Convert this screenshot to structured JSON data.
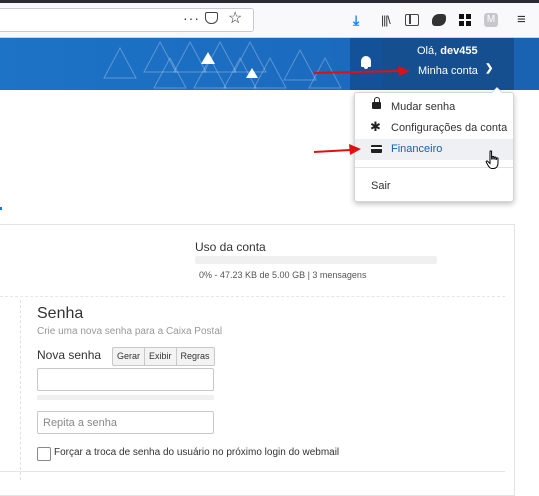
{
  "browser": {
    "url_actions_icon": "ellipsis-icon",
    "pocket_icon": "pocket-icon",
    "bookmark_icon": "star-icon",
    "toolbar_icons": [
      "download-icon",
      "library-icon",
      "sidebar-icon",
      "extension-icon",
      "grid-extension-icon",
      "profile-extension-icon",
      "hamburger-menu-icon"
    ],
    "profile_badge": "M"
  },
  "header": {
    "greeting_prefix": "Olá,",
    "username": "dev455",
    "account_menu_label": "Minha conta",
    "brand_color": "#1d73c6"
  },
  "account_menu": {
    "items": [
      {
        "label": "Mudar senha",
        "icon": "lock-icon"
      },
      {
        "label": "Configurações da conta",
        "icon": "gear-icon"
      },
      {
        "label": "Financeiro",
        "icon": "credit-card-icon",
        "highlighted": true
      },
      {
        "label": "Sair"
      }
    ]
  },
  "usage": {
    "title": "Uso da conta",
    "summary": "0% - 47.23 KB de 5.00 GB | 3 mensagens",
    "percent_used": 0
  },
  "password_section": {
    "title": "Senha",
    "subtitle": "Crie uma nova senha para a Caixa Postal",
    "new_password_label": "Nova senha",
    "buttons": [
      "Gerar",
      "Exibir",
      "Regras"
    ],
    "new_password_value": "",
    "repeat_placeholder": "Repita a senha",
    "force_change_label": "Forçar a troca de senha do usuário no próximo login do webmail",
    "force_change_checked": false
  },
  "annotation_color": "#e01010"
}
